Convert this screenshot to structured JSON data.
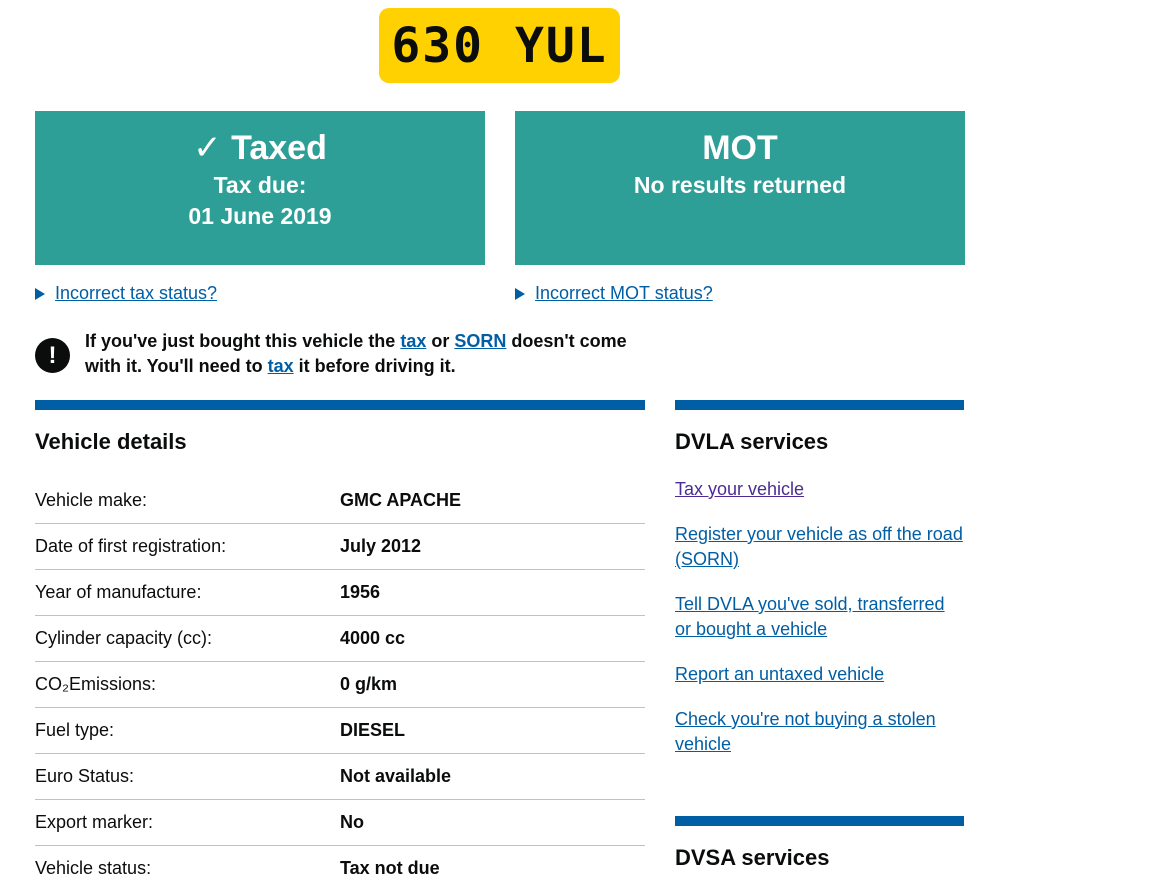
{
  "plate": {
    "registration": "630 YUL"
  },
  "tax_panel": {
    "check_glyph": "✓",
    "status": "Taxed",
    "due_label": "Tax due:",
    "due_date": "01 June 2019"
  },
  "mot_panel": {
    "title": "MOT",
    "status": "No results returned"
  },
  "toggles": {
    "tax": "Incorrect tax status?",
    "mot": "Incorrect MOT status?"
  },
  "warning": {
    "icon": "!",
    "part1": "If you've just bought this vehicle the ",
    "link_tax": "tax",
    "part2": " or ",
    "link_sorn": "SORN",
    "part3": " doesn't come with it. You'll need to ",
    "link_tax2": "tax",
    "part4": " it before driving it."
  },
  "vehicle_details": {
    "heading": "Vehicle details",
    "rows": [
      {
        "label": "Vehicle make:",
        "value": "GMC APACHE"
      },
      {
        "label": "Date of first registration:",
        "value": "July 2012"
      },
      {
        "label": "Year of manufacture:",
        "value": "1956"
      },
      {
        "label": "Cylinder capacity (cc):",
        "value": "4000 cc"
      },
      {
        "label": "CO₂Emissions:",
        "value": "0 g/km"
      },
      {
        "label": "Fuel type:",
        "value": "DIESEL"
      },
      {
        "label": "Euro Status:",
        "value": "Not available"
      },
      {
        "label": "Export marker:",
        "value": "No"
      },
      {
        "label": "Vehicle status:",
        "value": "Tax not due"
      }
    ]
  },
  "dvla_services": {
    "heading": "DVLA services",
    "links": [
      "Tax your vehicle",
      "Register your vehicle as off the road (SORN)",
      "Tell DVLA you've sold, transferred or bought a vehicle",
      "Report an untaxed vehicle",
      "Check you're not buying a stolen vehicle"
    ]
  },
  "dvsa_services": {
    "heading": "DVSA services"
  },
  "colors": {
    "panel": "#2e9f97",
    "link": "#005ea5",
    "visited": "#4c2c92",
    "plate": "#ffd100",
    "bar": "#005ea5"
  }
}
